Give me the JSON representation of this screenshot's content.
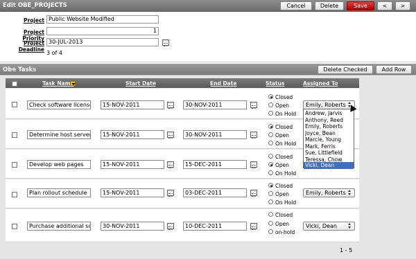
{
  "header": {
    "title": "Edit OBE_PROJECTS",
    "buttons": {
      "cancel": "Cancel",
      "delete": "Delete",
      "save": "Save",
      "prev": "<",
      "next": ">"
    }
  },
  "form": {
    "project_label": "Project",
    "project_value": "Public Website Modified",
    "priority_label": "Project Priority",
    "priority_value": "1",
    "deadline_label": "Project Deadline",
    "deadline_value": "30-JUL-2013",
    "record_count": "3 of 4"
  },
  "tasks": {
    "title": "Obe Tasks",
    "delete_checked": "Delete Checked",
    "add_row": "Add Row",
    "columns": {
      "task_name": "Task Name",
      "start_date": "Start Date",
      "end_date": "End Date",
      "status": "Status",
      "assigned_to": "Assigned To"
    },
    "rows": [
      {
        "task": "Check software licenses",
        "start": "15-NOV-2011",
        "end": "30-NOV-2011",
        "status_options": [
          "Closed",
          "Open",
          "On Hold"
        ],
        "status_selected": "Closed",
        "assigned": "Emily, Roberts"
      },
      {
        "task": "Determine host server",
        "start": "15-NOV-2011",
        "end": "30-NOV-2011",
        "status_options": [
          "Closed",
          "Open",
          "On Hold"
        ],
        "status_selected": "Closed",
        "assigned": ""
      },
      {
        "task": "Develop web pages",
        "start": "15-NOV-2011",
        "end": "15-DEC-2011",
        "status_options": [
          "Closed",
          "Open",
          "On Hold"
        ],
        "status_selected": "Open",
        "assigned": ""
      },
      {
        "task": "Plan rollout schedule",
        "start": "15-NOV-2011",
        "end": "03-DEC-2011",
        "status_options": [
          "Closed",
          "Open",
          "On Hold"
        ],
        "status_selected": "Closed",
        "assigned": "Emily, Roberts"
      },
      {
        "task": "Purchase additional software",
        "start": "30-NOV-2011",
        "end": "10-DEC-2011",
        "status_options": [
          "Closed",
          "Open",
          "on-hold"
        ],
        "status_selected": "",
        "assigned": "Vicki, Dean"
      }
    ],
    "dropdown_options": [
      "Andrew, Jarvis",
      "Anthony, Reed",
      "Emily, Roberts",
      "Joyce, Bean",
      "Marcie, Young",
      "Mark, Ferris",
      "Sue, Littlefield",
      "Teressa, Chow",
      "Vicki, Dean"
    ],
    "dropdown_highlighted": "Vicki, Dean",
    "pagination": "1 - 5"
  },
  "colors": {
    "save_button": "#c00000",
    "highlight": "#3d6fc8",
    "header_bar": "#7a7a7a"
  }
}
